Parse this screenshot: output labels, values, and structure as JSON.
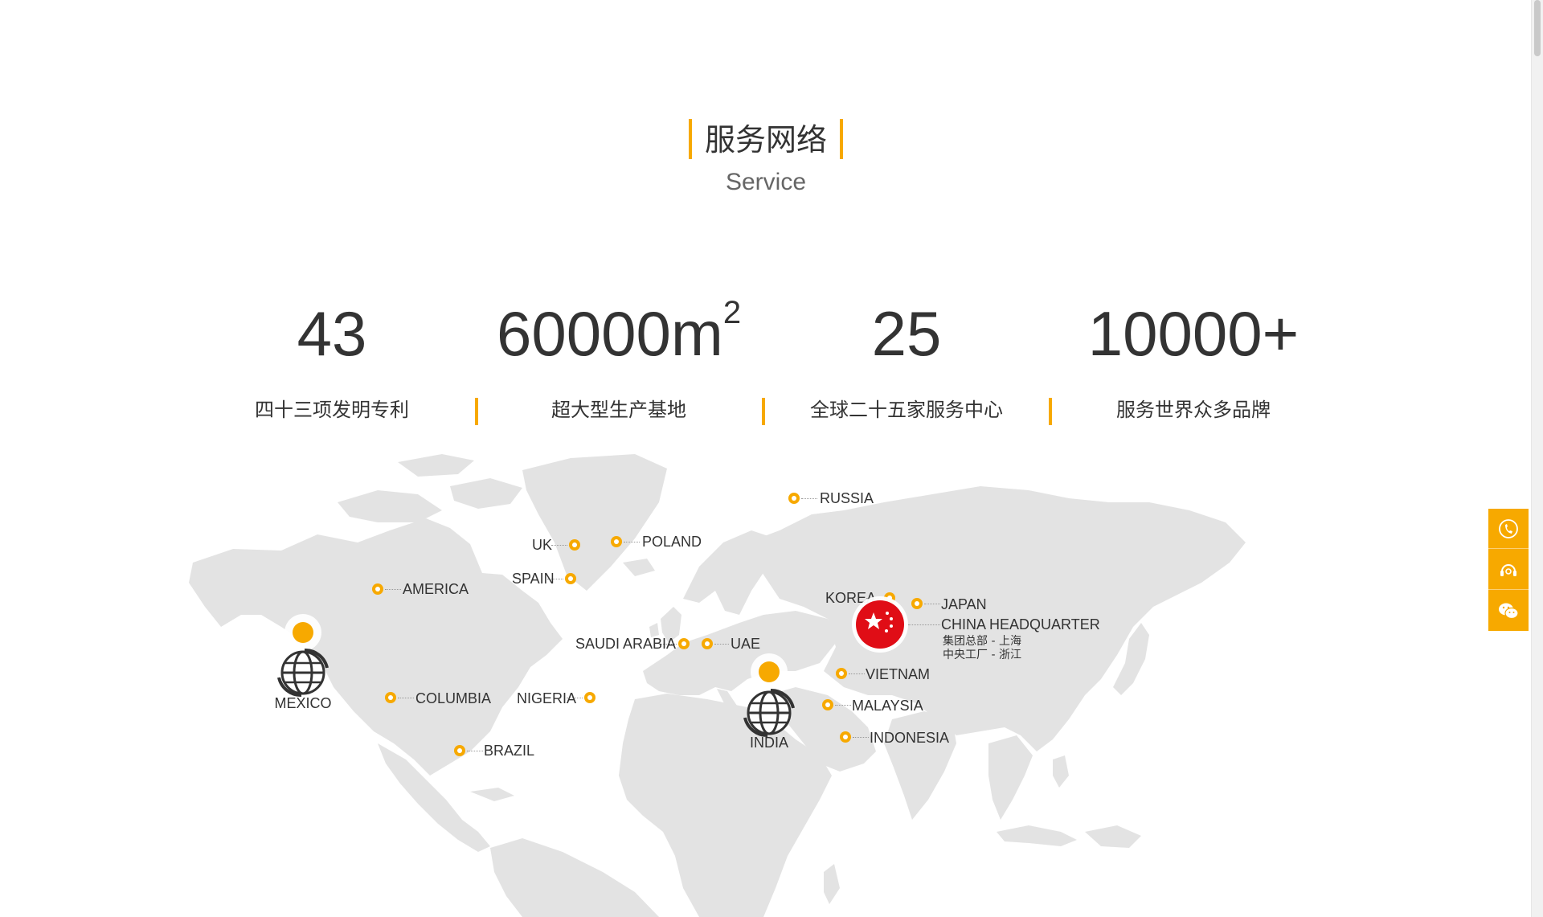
{
  "section": {
    "title": "服务网络",
    "subtitle": "Service"
  },
  "stats": [
    {
      "value": "43",
      "sup": "",
      "label": "四十三项发明专利"
    },
    {
      "value": "60000m",
      "sup": "2",
      "label": "超大型生产基地"
    },
    {
      "value": "25",
      "sup": "",
      "label": "全球二十五家服务中心"
    },
    {
      "value": "10000+",
      "sup": "",
      "label": "服务世界众多品牌"
    }
  ],
  "map": {
    "locations": {
      "russia": "RUSSIA",
      "poland": "POLAND",
      "uk": "UK",
      "spain": "SPAIN",
      "america": "AMERICA",
      "korea": "KOREA",
      "japan": "JAPAN",
      "china_hq": "CHINA HEADQUARTER",
      "china_hq_line1": "集团总部 - 上海",
      "china_hq_line2": "中央工厂 - 浙江",
      "saudi": "SAUDI ARABIA",
      "uae": "UAE",
      "vietnam": "VIETNAM",
      "malaysia": "MALAYSIA",
      "indonesia": "INDONESIA",
      "columbia": "COLUMBIA",
      "nigeria": "NIGERIA",
      "brazil": "BRAZIL",
      "mexico": "MEXICO",
      "india": "INDIA"
    }
  },
  "colors": {
    "accent": "#f7a900",
    "hq": "#e00d16",
    "land": "#e3e3e3"
  },
  "sidebar": {
    "icons": [
      "phone-icon",
      "headset-icon",
      "wechat-icon"
    ]
  }
}
